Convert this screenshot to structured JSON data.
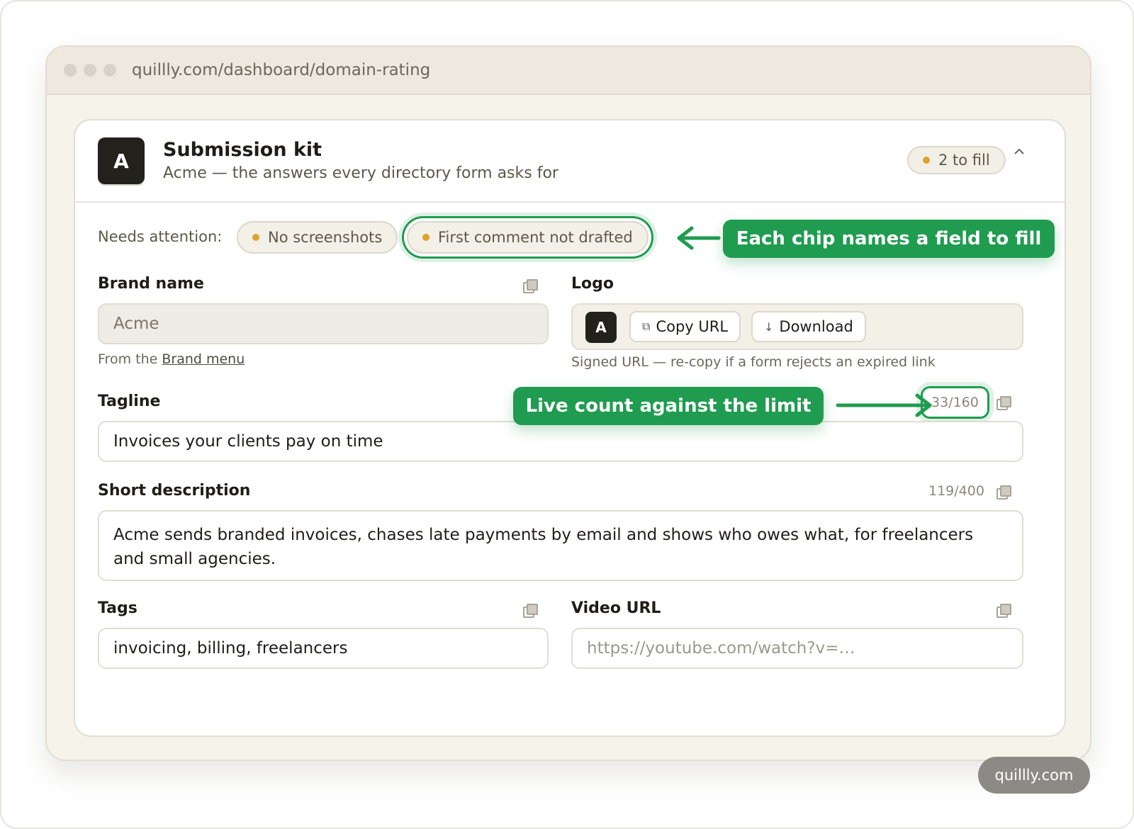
{
  "browser": {
    "url": "quillly.com/dashboard/domain-rating"
  },
  "card": {
    "avatar_letter": "A",
    "title": "Submission kit",
    "subtitle": "Acme — the answers every directory form asks for",
    "fill_badge": "2 to fill",
    "collapse_icon": "^"
  },
  "attention": {
    "label": "Needs attention:",
    "chips": [
      "No screenshots",
      "First comment not drafted"
    ]
  },
  "callouts": {
    "chips": "Each chip names a field to fill",
    "counter": "Live count against the limit",
    "color": "#1f9c4f"
  },
  "fields": {
    "brand_name": {
      "label": "Brand name",
      "value": "Acme",
      "hint_prefix": "From the ",
      "hint_link": "Brand menu"
    },
    "logo": {
      "label": "Logo",
      "thumb_letter": "A",
      "copy_label": "Copy URL",
      "download_label": "Download",
      "hint": "Signed URL — re-copy if a form rejects an expired link"
    },
    "tagline": {
      "label": "Tagline",
      "value": "Invoices your clients pay on time",
      "count": "33/160"
    },
    "short_description": {
      "label": "Short description",
      "value": "Acme sends branded invoices, chases late payments by email and shows who owes what, for freelancers and small agencies.",
      "count": "119/400"
    },
    "tags": {
      "label": "Tags",
      "value": "invoicing, billing, freelancers"
    },
    "video_url": {
      "label": "Video URL",
      "placeholder": "https://youtube.com/watch?v=…"
    }
  },
  "footer": {
    "badge": "quillly.com"
  },
  "icons": {
    "copy": "copy-icon",
    "download": "download-icon",
    "collapse": "chevron-up-icon"
  }
}
